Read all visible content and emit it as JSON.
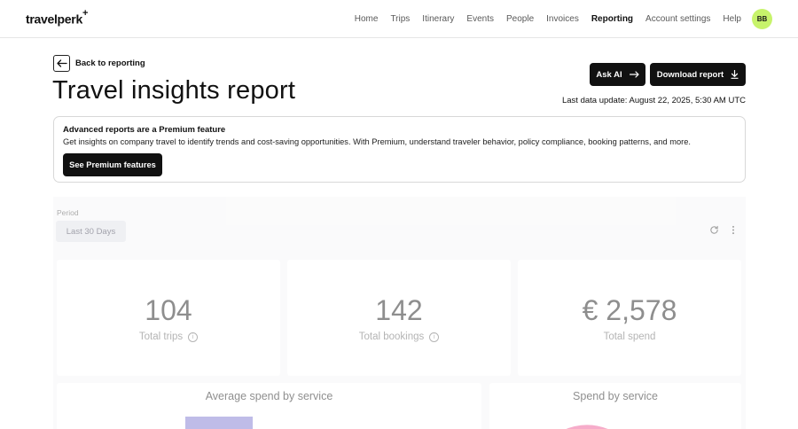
{
  "header": {
    "logo": "travelperk",
    "logo_mark": "+",
    "nav": [
      "Home",
      "Trips",
      "Itinerary",
      "Events",
      "People",
      "Invoices",
      "Reporting",
      "Account settings",
      "Help"
    ],
    "active_nav": "Reporting",
    "avatar_initials": "BB"
  },
  "page": {
    "back_label": "Back to reporting",
    "title": "Travel insights report",
    "ask_ai_label": "Ask AI",
    "download_label": "Download report",
    "last_update": "Last data update: August 22, 2025, 5:30 AM UTC"
  },
  "banner": {
    "title": "Advanced reports are a Premium feature",
    "text": "Get insights on company travel to identify trends and cost-saving opportunities. With Premium, understand traveler behavior, policy compliance, booking patterns, and more.",
    "button": "See Premium features"
  },
  "dashboard": {
    "period_label": "Period",
    "period_value": "Last 30 Days",
    "kpis": [
      {
        "value": "104",
        "label": "Total trips",
        "info": true
      },
      {
        "value": "142",
        "label": "Total bookings",
        "info": true
      },
      {
        "value": "€ 2,578",
        "label": "Total spend",
        "info": false
      }
    ],
    "charts": [
      "Average spend by service",
      "Spend by service"
    ]
  },
  "colors": {
    "avatar": "#c7f36b",
    "bar_accent": "#8c86d6",
    "pie_accent": "#f06aa0"
  }
}
